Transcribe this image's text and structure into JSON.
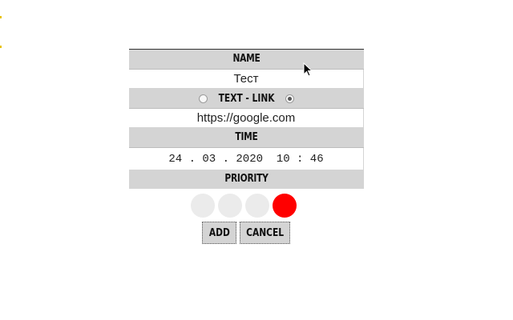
{
  "form": {
    "name_label": "NAME",
    "name_value": "Тест",
    "type_label": "TEXT - LINK",
    "type_options": [
      "TEXT",
      "LINK"
    ],
    "type_selected": "LINK",
    "link_value": "https://google.com",
    "time_label": "TIME",
    "time_value": "24 . 03 . 2020  10 : 46",
    "priority_label": "PRIORITY",
    "priority_levels": 4,
    "priority_selected": 4,
    "priority_active_color": "#ff0000",
    "priority_inactive_color": "#ebebeb"
  },
  "buttons": {
    "add_label": "ADD",
    "cancel_label": "CANCEL"
  },
  "icons": {
    "cursor": "mouse-pointer-icon"
  }
}
